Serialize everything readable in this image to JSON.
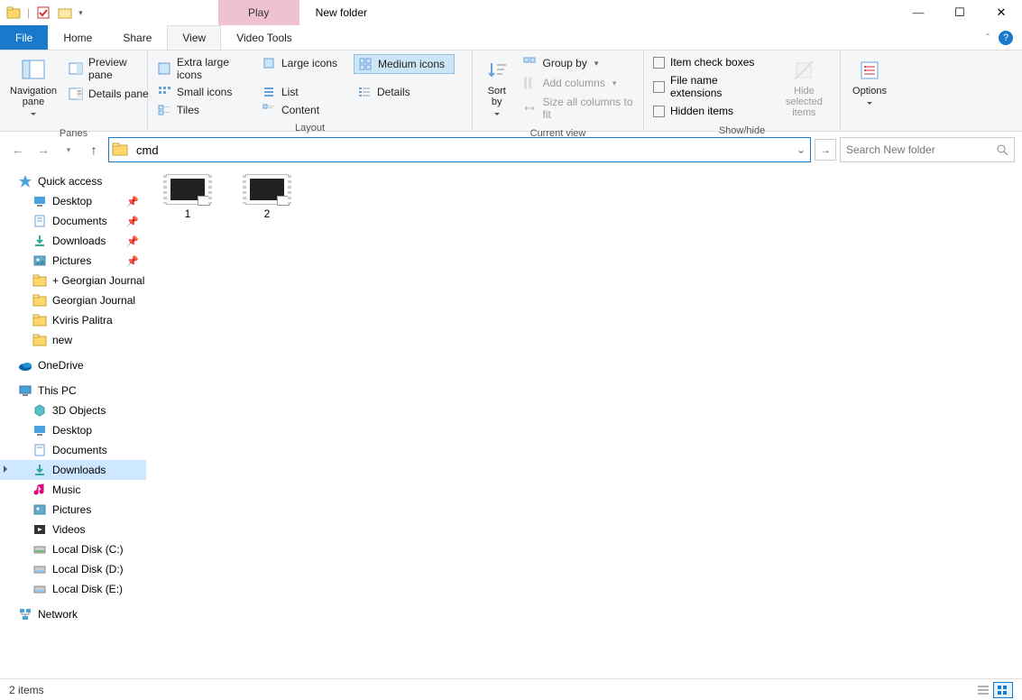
{
  "titlebar": {
    "contextual_tab": "Play",
    "title": "New folder"
  },
  "tabs": {
    "file": "File",
    "home": "Home",
    "share": "Share",
    "view": "View",
    "video_tools": "Video Tools"
  },
  "ribbon": {
    "panes": {
      "label": "Panes",
      "navigation_pane": "Navigation pane",
      "preview_pane": "Preview pane",
      "details_pane": "Details pane"
    },
    "layout": {
      "label": "Layout",
      "extra_large_icons": "Extra large icons",
      "large_icons": "Large icons",
      "medium_icons": "Medium icons",
      "small_icons": "Small icons",
      "list": "List",
      "details": "Details",
      "tiles": "Tiles",
      "content": "Content"
    },
    "current_view": {
      "label": "Current view",
      "sort_by": "Sort by",
      "group_by": "Group by",
      "add_columns": "Add columns",
      "size_all_columns": "Size all columns to fit"
    },
    "show_hide": {
      "label": "Show/hide",
      "item_check_boxes": "Item check boxes",
      "file_name_extensions": "File name extensions",
      "hidden_items": "Hidden items",
      "hide_selected": "Hide selected items"
    },
    "options": "Options"
  },
  "address": {
    "value": "cmd"
  },
  "search": {
    "placeholder": "Search New folder"
  },
  "navpane": {
    "quick_access": "Quick access",
    "items_qa": [
      {
        "label": "Desktop",
        "pinned": true
      },
      {
        "label": "Documents",
        "pinned": true
      },
      {
        "label": "Downloads",
        "pinned": true
      },
      {
        "label": "Pictures",
        "pinned": true
      },
      {
        "label": "+ Georgian Journal",
        "pinned": false
      },
      {
        "label": "Georgian Journal",
        "pinned": false
      },
      {
        "label": "Kviris Palitra",
        "pinned": false
      },
      {
        "label": "new",
        "pinned": false
      }
    ],
    "onedrive": "OneDrive",
    "this_pc": "This PC",
    "items_pc": [
      "3D Objects",
      "Desktop",
      "Documents",
      "Downloads",
      "Music",
      "Pictures",
      "Videos",
      "Local Disk (C:)",
      "Local Disk (D:)",
      "Local Disk (E:)"
    ],
    "network": "Network",
    "selected": "Downloads"
  },
  "files": [
    {
      "name": "1"
    },
    {
      "name": "2"
    }
  ],
  "status": {
    "count": "2 items"
  }
}
